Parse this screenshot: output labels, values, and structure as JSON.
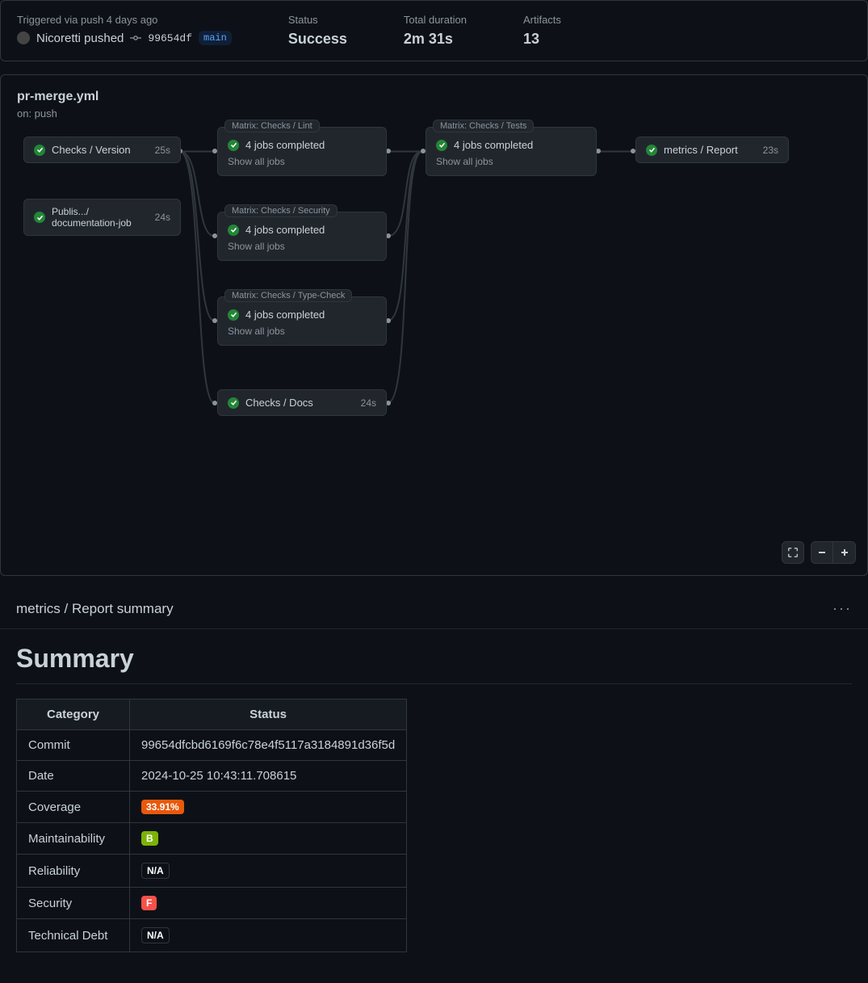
{
  "header": {
    "trigger_line": "Triggered via push 4 days ago",
    "actor": "Nicoretti pushed",
    "sha": "99654df",
    "branch": "main",
    "status_label": "Status",
    "status_value": "Success",
    "duration_label": "Total duration",
    "duration_value": "2m 31s",
    "artifacts_label": "Artifacts",
    "artifacts_value": "13"
  },
  "workflow": {
    "file": "pr-merge.yml",
    "on": "on: push",
    "show_all": "Show all jobs",
    "jobs": {
      "version": {
        "name": "Checks / Version",
        "time": "25s"
      },
      "doc": {
        "name": "Publis.../ documentation-job",
        "time": "24s"
      },
      "lint": {
        "label": "Matrix: Checks / Lint",
        "completed": "4 jobs completed"
      },
      "security": {
        "label": "Matrix: Checks / Security",
        "completed": "4 jobs completed"
      },
      "typecheck": {
        "label": "Matrix: Checks / Type-Check",
        "completed": "4 jobs completed"
      },
      "docs": {
        "name": "Checks / Docs",
        "time": "24s"
      },
      "tests": {
        "label": "Matrix: Checks / Tests",
        "completed": "4 jobs completed"
      },
      "report": {
        "name": "metrics / Report",
        "time": "23s"
      }
    }
  },
  "summary": {
    "header_title": "metrics / Report summary",
    "heading": "Summary",
    "cols": {
      "category": "Category",
      "status": "Status"
    },
    "rows": {
      "commit": {
        "k": "Commit",
        "v": "99654dfcbd6169f6c78e4f5117a3184891d36f5d"
      },
      "date": {
        "k": "Date",
        "v": "2024-10-25 10:43:11.708615"
      },
      "coverage": {
        "k": "Coverage",
        "v": "33.91%",
        "color": "orange"
      },
      "maintain": {
        "k": "Maintainability",
        "v": "B",
        "color": "green"
      },
      "reliability": {
        "k": "Reliability",
        "v": "N/A",
        "color": "dark"
      },
      "security": {
        "k": "Security",
        "v": "F",
        "color": "red"
      },
      "debt": {
        "k": "Technical Debt",
        "v": "N/A",
        "color": "dark"
      }
    }
  }
}
